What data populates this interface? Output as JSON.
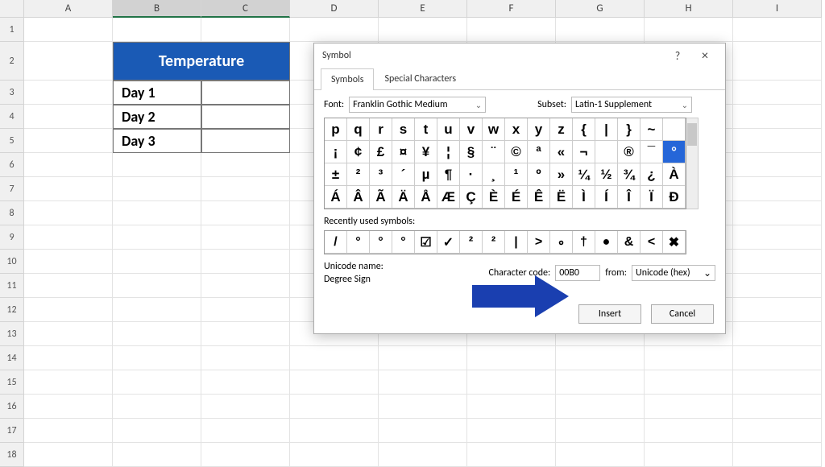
{
  "sheet": {
    "columns": [
      "A",
      "B",
      "C",
      "D",
      "E",
      "F",
      "G",
      "H",
      "I"
    ],
    "selectedCols": [
      "B",
      "C"
    ],
    "rows": [
      "1",
      "2",
      "3",
      "4",
      "5",
      "6",
      "7",
      "8",
      "9",
      "10",
      "11",
      "12",
      "13",
      "14",
      "15",
      "16",
      "17",
      "18"
    ],
    "tempHeader": "Temperature",
    "days": [
      "Day 1",
      "Day 2",
      "Day 3"
    ]
  },
  "dialog": {
    "title": "Symbol",
    "help": "?",
    "close": "×",
    "tabs": {
      "symbols": "Symbols",
      "special": "Special Characters"
    },
    "fontLabel": "Font:",
    "font": "Franklin Gothic Medium",
    "subsetLabel": "Subset:",
    "subset": "Latin-1 Supplement",
    "grid": [
      "p",
      "q",
      "r",
      "s",
      "t",
      "u",
      "v",
      "w",
      "x",
      "y",
      "z",
      "{",
      "|",
      "}",
      "~",
      "",
      "¡",
      "¢",
      "£",
      "¤",
      "¥",
      "¦",
      "§",
      "¨",
      "©",
      "ª",
      "«",
      "¬",
      "­",
      "®",
      "¯",
      "°",
      "±",
      "²",
      "³",
      "´",
      "µ",
      "¶",
      "·",
      "¸",
      "¹",
      "º",
      "»",
      "¼",
      "½",
      "¾",
      "¿",
      "À",
      "Á",
      "Â",
      "Ã",
      "Ä",
      "Å",
      "Æ",
      "Ç",
      "È",
      "É",
      "Ê",
      "Ë",
      "Ì",
      "Í",
      "Î",
      "Ï",
      "Ð"
    ],
    "selectedIndex": 31,
    "recentLabel": "Recently used symbols:",
    "recent": [
      "/",
      "°",
      "°",
      "°",
      "☑",
      "✓",
      "²",
      "²",
      "|",
      ">",
      "∘",
      "†",
      "●",
      "&",
      "<",
      "✖"
    ],
    "unicodeNameLabel": "Unicode name:",
    "unicodeName": "Degree Sign",
    "charCodeLabel": "Character code:",
    "charCode": "00B0",
    "fromLabel": "from:",
    "from": "Unicode (hex)",
    "insert": "Insert",
    "cancel": "Cancel"
  }
}
